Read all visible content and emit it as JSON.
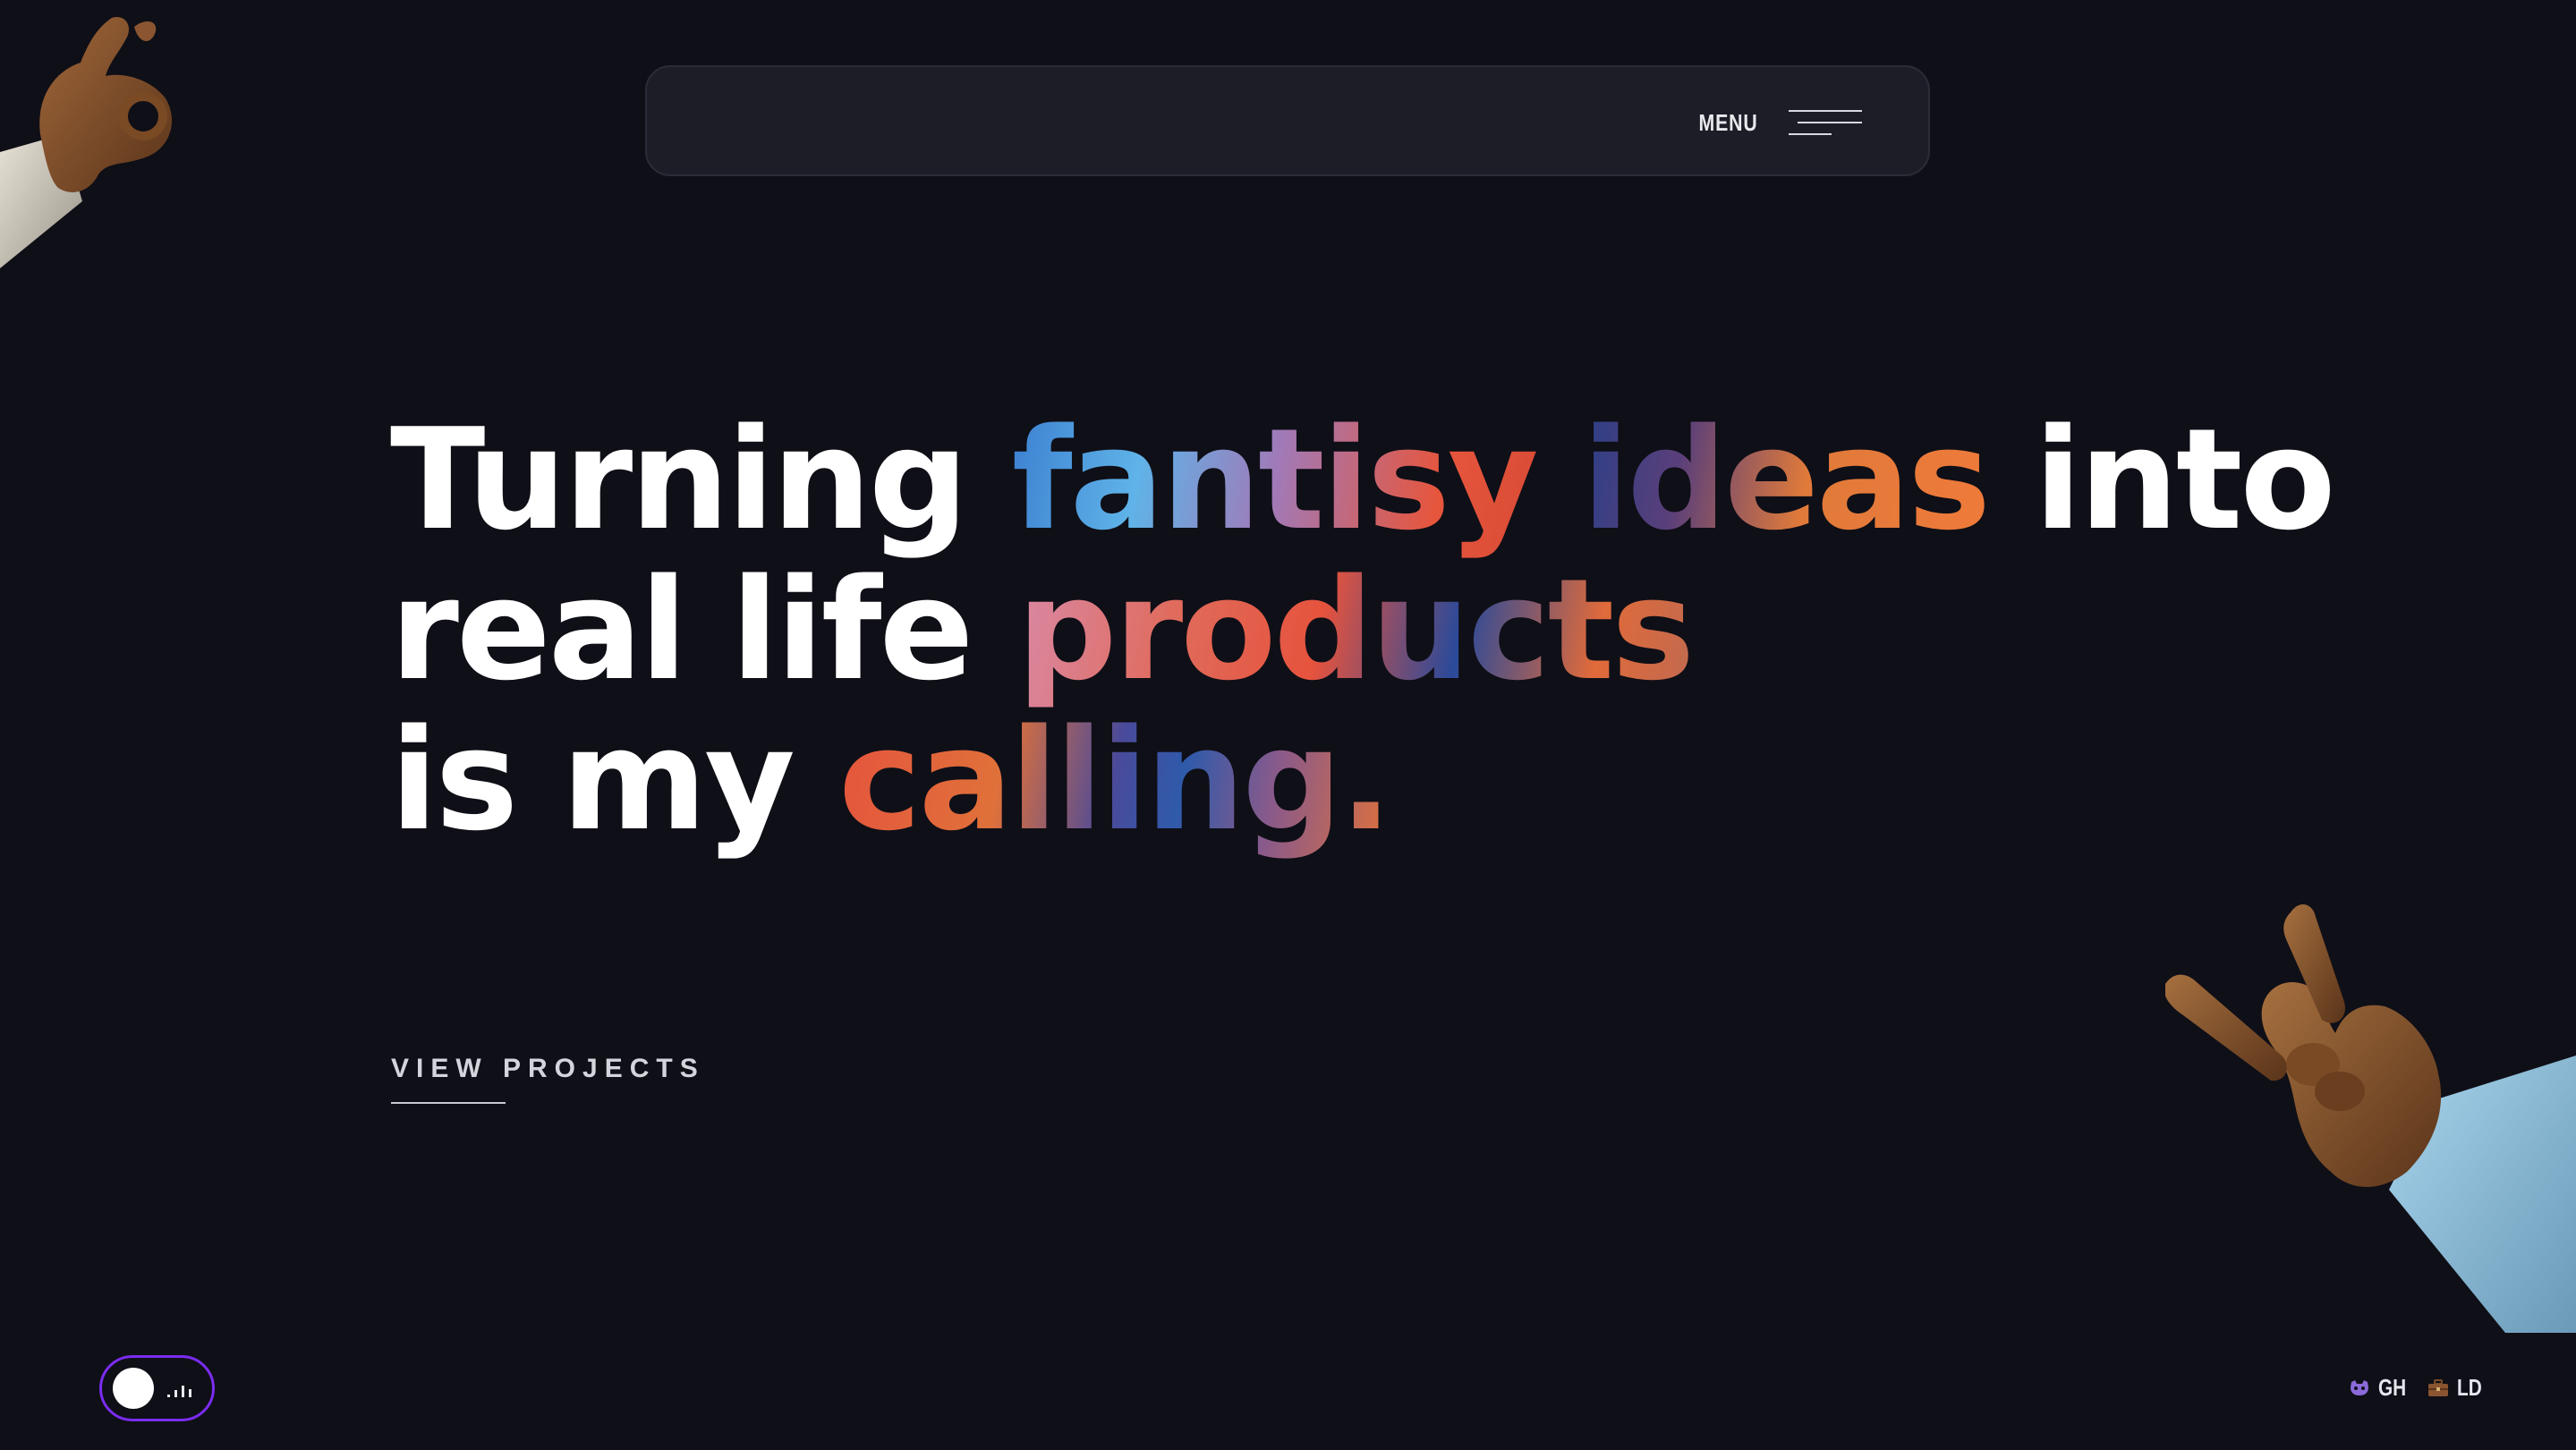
{
  "nav": {
    "menu_label": "MENU"
  },
  "hero": {
    "line1": [
      {
        "text": "Turning ",
        "style": "plain"
      },
      {
        "text": "fantisy",
        "style": "gradient"
      },
      {
        "text": " ",
        "style": "plain"
      },
      {
        "text": "ideas",
        "style": "gradient"
      },
      {
        "text": " into",
        "style": "plain"
      }
    ],
    "line1_word1": "Turning",
    "line1_word2": "fantisy",
    "line1_word3": "ideas",
    "line1_word4": "into",
    "line2_word1": "real life",
    "line2_word2": "products",
    "line3_word1": "is my",
    "line3_word2": "calling."
  },
  "cta": {
    "view_projects_label": "VIEW PROJECTS"
  },
  "sound_toggle": {
    "state": "on"
  },
  "social": {
    "github_label": "GH",
    "linkedin_label": "LD"
  },
  "colors": {
    "background": "#0f0f17",
    "navbar": "#1d1d27",
    "accent_purple": "#7a2cf0",
    "text": "#ffffff"
  },
  "icons": [
    "menu-hamburger-icon",
    "sound-bars-icon",
    "github-icon",
    "briefcase-icon",
    "ok-hand-illustration",
    "horns-hand-illustration"
  ]
}
